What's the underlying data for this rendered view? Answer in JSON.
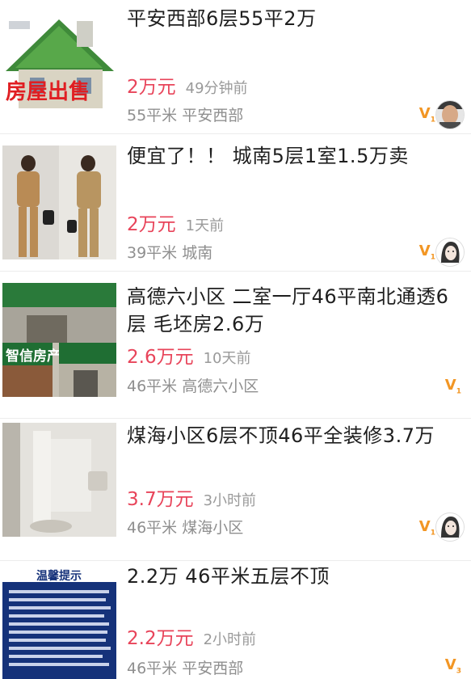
{
  "listings": [
    {
      "title": "平安西部6层55平2万",
      "price": "2万元",
      "time": "49分钟前",
      "meta": "55平米 平安西部",
      "badge_level": "1",
      "image_text": "房屋出售"
    },
    {
      "title": "便宜了！！ 城南5层1室1.5万卖",
      "price": "2万元",
      "time": "1天前",
      "meta": "39平米 城南",
      "badge_level": "1"
    },
    {
      "title": "高德六小区 二室一厅46平南北通透6层 毛坯房2.6万",
      "price": "2.6万元",
      "time": "10天前",
      "meta": "46平米 高德六小区",
      "badge_level": "1",
      "image_text": "智信房产"
    },
    {
      "title": "煤海小区6层不顶46平全装修3.7万",
      "price": "3.7万元",
      "time": "3小时前",
      "meta": "46平米 煤海小区",
      "badge_level": "1"
    },
    {
      "title": "2.2万 46平米五层不顶",
      "price": "2.2万元",
      "time": "2小时前",
      "meta": "46平米 平安西部",
      "badge_level": "3",
      "image_text": "温馨提示"
    }
  ],
  "colors": {
    "price": "#e8445a",
    "badge": "#f29624",
    "title": "#1f1f1f",
    "meta": "#8f8f8f"
  }
}
